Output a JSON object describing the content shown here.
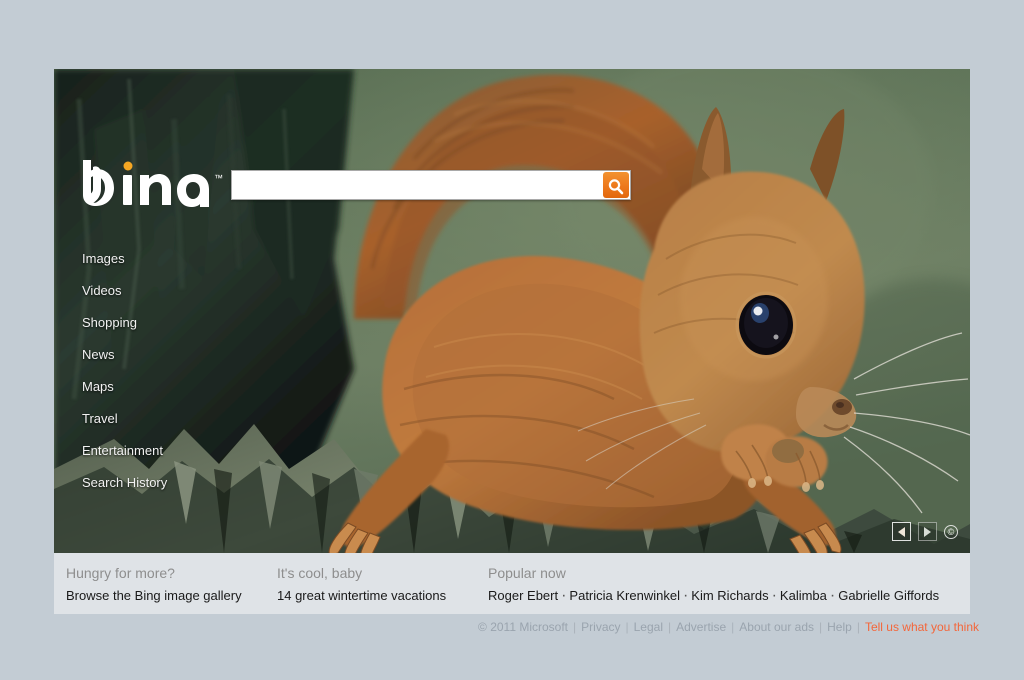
{
  "brand": {
    "name": "bing",
    "trademark": "™",
    "accent_color": "#ee7b1e",
    "dot_color": "#f5a623"
  },
  "search": {
    "value": "",
    "placeholder": "",
    "button_label": "Search",
    "button_icon": "magnifier-icon"
  },
  "nav": {
    "items": [
      {
        "label": "Images"
      },
      {
        "label": "Videos"
      },
      {
        "label": "Shopping"
      },
      {
        "label": "News"
      },
      {
        "label": "Maps"
      },
      {
        "label": "Travel"
      },
      {
        "label": "Entertainment"
      },
      {
        "label": "Search History"
      }
    ]
  },
  "hero": {
    "description": "Red squirrel perched on a weathered tree stump eating a nut, green bokeh background",
    "controls": {
      "previous_label": "◀",
      "next_label": "▶",
      "copyright_label": "©"
    },
    "colors": {
      "background_green": "#5c7259",
      "fur_orange": "#c36a2a",
      "bark_dark": "#121611"
    }
  },
  "infobar": {
    "columns": [
      {
        "heading": "Hungry for more?",
        "link": "Browse the Bing image gallery"
      },
      {
        "heading": "It's cool, baby",
        "link": "14 great wintertime vacations"
      }
    ],
    "popular": {
      "heading": "Popular now",
      "separator": "·",
      "items": [
        "Roger Ebert",
        "Patricia Krenwinkel",
        "Kim Richards",
        "Kalimba",
        "Gabrielle Giffords"
      ]
    }
  },
  "footer": {
    "copyright": "© 2011 Microsoft",
    "separator": "|",
    "links": [
      {
        "label": "Privacy",
        "accent": false
      },
      {
        "label": "Legal",
        "accent": false
      },
      {
        "label": "Advertise",
        "accent": false
      },
      {
        "label": "About our ads",
        "accent": false
      },
      {
        "label": "Help",
        "accent": false
      },
      {
        "label": "Tell us what you think",
        "accent": true
      }
    ],
    "accent_color": "#f4663a"
  }
}
